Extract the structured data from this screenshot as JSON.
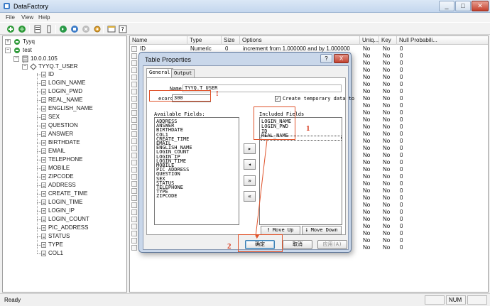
{
  "window": {
    "title": "DataFactory",
    "min_icon": "minimize-icon",
    "max_icon": "maximize-icon",
    "close_icon": "close-icon"
  },
  "menu": {
    "items": [
      "File",
      "View",
      "Help"
    ]
  },
  "toolbar": {
    "icons": [
      "add-database-icon",
      "connect-icon",
      "properties-icon",
      "column-icon",
      "refresh-icon",
      "stop-icon",
      "cancel-icon",
      "settings-icon",
      "table-icon",
      "help-icon"
    ]
  },
  "tree": {
    "nodes": [
      {
        "label": "Tyyq",
        "icon": "database-icon"
      },
      {
        "label": "test",
        "icon": "database-icon"
      },
      {
        "label": "10.0.0.105",
        "icon": "server-icon"
      },
      {
        "label": "TYYQ.T_USER",
        "icon": "table-icon"
      }
    ],
    "fields": [
      "ID",
      "LOGIN_NAME",
      "LOGIN_PWD",
      "REAL_NAME",
      "ENGLISH_NAME",
      "SEX",
      "QUESTION",
      "ANSWER",
      "BIRTHDATE",
      "EMAIL",
      "TELEPHONE",
      "MOBILE",
      "ZIPCODE",
      "ADDRESS",
      "CREATE_TIME",
      "LOGIN_TIME",
      "LOGIN_IP",
      "LOGIN_COUNT",
      "PIC_ADDRESS",
      "STATUS",
      "TYPE",
      "COL1"
    ]
  },
  "grid": {
    "headers": [
      "Name",
      "Type",
      "Size",
      "Options",
      "Uniq...",
      "Key",
      "Null Probabili..."
    ],
    "first_row": {
      "name": "ID",
      "type": "Numeric",
      "size": "0",
      "options": "increment from 1.000000 and by 1.000000",
      "uniq": "No",
      "key": "No",
      "null": "0"
    },
    "other_rows": {
      "uniq": "No",
      "key": "No",
      "null": "0"
    },
    "row_count": 29
  },
  "dialog": {
    "title": "Table Properties",
    "help_label": "?",
    "close_label": "X",
    "tabs": [
      "General",
      "Output"
    ],
    "name_label": "Name:",
    "name_value": "TYYQ.T_USER",
    "records_label": "ecords:",
    "records_value": "300",
    "create_temp_label": "Create temporary data to",
    "available_label": "Available Fields:",
    "available_fields": [
      "ADDRESS",
      "ANSWER",
      "BIRTHDATE",
      "COL1",
      "CREATE_TIME",
      "EMAIL",
      "ENGLISH_NAME",
      "LOGIN_COUNT",
      "LOGIN_IP",
      "LOGIN_TIME",
      "MOBILE",
      "PIC_ADDRESS",
      "QUESTION",
      "SEX",
      "STATUS",
      "TELEPHONE",
      "TYPE",
      "ZIPCODE"
    ],
    "included_label": "Included Fields",
    "included_fields": [
      "LOGIN_NAME",
      "LOGIN_PWD",
      "ID",
      "REAL_NAME"
    ],
    "move_buttons": [
      "▸",
      "◂",
      "»",
      "«"
    ],
    "move_up": "Move Up",
    "move_down": "Move Down",
    "ok": "确定",
    "cancel": "取消",
    "apply": "应用(A)"
  },
  "annotations": {
    "one": "1",
    "two": "2",
    "bang": "!"
  },
  "status": {
    "text": "Ready",
    "num": "NUM"
  },
  "colors": {
    "accent": "#e0532b",
    "titlebar": "#c4d7ee"
  }
}
